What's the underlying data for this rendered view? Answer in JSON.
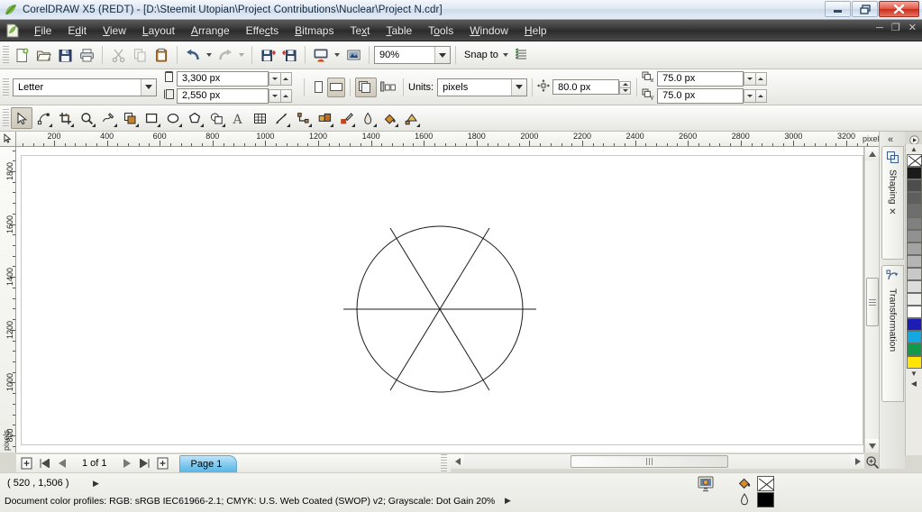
{
  "window": {
    "title": "CorelDRAW X5 (REDT) - [D:\\Steemit Utopian\\Project Contributions\\Nuclear\\Project N.cdr]",
    "app_icon": "coreldraw-icon",
    "minimize_label": "—",
    "restore_label": "❐",
    "close_label": "✕",
    "mdi_minimize": "—",
    "mdi_restore": "❐",
    "mdi_close": "✕"
  },
  "menu": {
    "items": [
      {
        "label": "File",
        "accel": "F"
      },
      {
        "label": "Edit",
        "accel": "E"
      },
      {
        "label": "View",
        "accel": "V"
      },
      {
        "label": "Layout",
        "accel": "L"
      },
      {
        "label": "Arrange",
        "accel": "A"
      },
      {
        "label": "Effects",
        "accel": "c"
      },
      {
        "label": "Bitmaps",
        "accel": "B"
      },
      {
        "label": "Text",
        "accel": "x"
      },
      {
        "label": "Table",
        "accel": "T"
      },
      {
        "label": "Tools",
        "accel": "o"
      },
      {
        "label": "Window",
        "accel": "W"
      },
      {
        "label": "Help",
        "accel": "H"
      }
    ]
  },
  "standard_toolbar": {
    "buttons": [
      {
        "name": "new-document-button",
        "tooltip": "New"
      },
      {
        "name": "open-document-button",
        "tooltip": "Open"
      },
      {
        "name": "save-document-button",
        "tooltip": "Save"
      },
      {
        "name": "print-button",
        "tooltip": "Print"
      },
      {
        "name": "cut-button",
        "tooltip": "Cut"
      },
      {
        "name": "copy-button",
        "tooltip": "Copy"
      },
      {
        "name": "paste-button",
        "tooltip": "Paste"
      },
      {
        "name": "undo-button",
        "tooltip": "Undo"
      },
      {
        "name": "redo-button",
        "tooltip": "Redo"
      },
      {
        "name": "import-button",
        "tooltip": "Import"
      },
      {
        "name": "export-button",
        "tooltip": "Export"
      },
      {
        "name": "publish-pdf-button",
        "tooltip": "Publish to PDF"
      },
      {
        "name": "application-launcher-button",
        "tooltip": "Application Launcher"
      }
    ],
    "zoom_level": "90%",
    "snap_to_label": "Snap to",
    "options_button": "options-button"
  },
  "property_bar": {
    "paper_type": "Letter",
    "page_width": "3,300 px",
    "page_height": "2,550 px",
    "orientation_portrait": "portrait-button",
    "orientation_landscape": "landscape-button",
    "all_pages_button": "all-pages-button",
    "current_page_button": "current-page-button",
    "units_label": "Units:",
    "units_value": "pixels",
    "nudge_offset": "80.0 px",
    "duplicate_x": "75.0 px",
    "duplicate_y": "75.0 px"
  },
  "toolbox": {
    "tools": [
      {
        "name": "pick-tool",
        "label": "Pick",
        "selected": true,
        "flyout": false
      },
      {
        "name": "shape-tool",
        "label": "Shape",
        "selected": false,
        "flyout": true
      },
      {
        "name": "crop-tool",
        "label": "Crop",
        "selected": false,
        "flyout": true
      },
      {
        "name": "zoom-tool",
        "label": "Zoom",
        "selected": false,
        "flyout": true
      },
      {
        "name": "freehand-tool",
        "label": "Freehand",
        "selected": false,
        "flyout": true
      },
      {
        "name": "smart-fill-tool",
        "label": "Smart Fill",
        "selected": false,
        "flyout": true
      },
      {
        "name": "rectangle-tool",
        "label": "Rectangle",
        "selected": false,
        "flyout": true
      },
      {
        "name": "ellipse-tool",
        "label": "Ellipse",
        "selected": false,
        "flyout": true
      },
      {
        "name": "polygon-tool",
        "label": "Polygon",
        "selected": false,
        "flyout": true
      },
      {
        "name": "basic-shapes-tool",
        "label": "Basic Shapes",
        "selected": false,
        "flyout": true
      },
      {
        "name": "text-tool",
        "label": "Text",
        "selected": false,
        "flyout": false
      },
      {
        "name": "table-tool",
        "label": "Table",
        "selected": false,
        "flyout": false
      },
      {
        "name": "dimension-tool",
        "label": "Dimension",
        "selected": false,
        "flyout": true
      },
      {
        "name": "connector-tool",
        "label": "Connector",
        "selected": false,
        "flyout": true
      },
      {
        "name": "blend-tool",
        "label": "Blend",
        "selected": false,
        "flyout": true
      },
      {
        "name": "color-eyedropper-tool",
        "label": "Color Eyedropper",
        "selected": false,
        "flyout": true
      },
      {
        "name": "outline-tool",
        "label": "Outline",
        "selected": false,
        "flyout": true
      },
      {
        "name": "fill-tool",
        "label": "Fill",
        "selected": false,
        "flyout": true
      },
      {
        "name": "interactive-fill-tool",
        "label": "Interactive Fill",
        "selected": false,
        "flyout": true
      }
    ]
  },
  "rulers": {
    "units": "pixels",
    "horizontal_ticks": [
      200,
      400,
      600,
      800,
      1000,
      1200,
      1400,
      1600,
      1800,
      2000,
      2200,
      2400,
      2600,
      2800,
      3000,
      3200
    ],
    "vertical_ticks": [
      1800,
      1600,
      1400,
      1200,
      1000,
      800
    ]
  },
  "dock": {
    "collapse_label": "«",
    "tabs": [
      {
        "name": "shaping-docker",
        "label": "Shaping",
        "icon": "shaping-icon",
        "close": "✕"
      },
      {
        "name": "transformation-docker",
        "label": "Transformation",
        "icon": "transformation-icon",
        "close": ""
      }
    ]
  },
  "palette": {
    "scroll_up": "▲",
    "scroll_down": "▼",
    "expand": "◀",
    "colors": [
      {
        "name": "no-color",
        "hex": "none"
      },
      {
        "name": "black",
        "hex": "#1a1a1a"
      },
      {
        "name": "gray-90",
        "hex": "#4d4d4d"
      },
      {
        "name": "gray-80",
        "hex": "#5e5e5e"
      },
      {
        "name": "gray-70",
        "hex": "#6e6e6e"
      },
      {
        "name": "gray-60",
        "hex": "#808080"
      },
      {
        "name": "gray-50",
        "hex": "#919191"
      },
      {
        "name": "gray-40",
        "hex": "#a3a3a3"
      },
      {
        "name": "gray-30",
        "hex": "#b5b5b5"
      },
      {
        "name": "gray-20",
        "hex": "#c8c8c8"
      },
      {
        "name": "gray-10",
        "hex": "#dcdcdc"
      },
      {
        "name": "gray-05",
        "hex": "#ececec"
      },
      {
        "name": "white",
        "hex": "#ffffff"
      },
      {
        "name": "blue",
        "hex": "#1d1db5"
      },
      {
        "name": "cyan",
        "hex": "#13a8e0"
      },
      {
        "name": "green",
        "hex": "#12994a"
      },
      {
        "name": "yellow",
        "hex": "#ffe400"
      }
    ]
  },
  "page_navigator": {
    "add_page_start": "add-page-before-button",
    "first_page": "⏮",
    "prev_page": "◀",
    "page_count_label": "1 of 1",
    "next_page": "▶",
    "last_page": "⏭",
    "add_page_end": "add-page-after-button",
    "tabs": [
      {
        "label": "Page 1",
        "active": true
      }
    ]
  },
  "status_bar": {
    "cursor_coordinates": "( 520  , 1,506 )",
    "coord_expand": "▶",
    "color_profiles": "Document color profiles: RGB: sRGB IEC61966-2.1; CMYK: U.S. Web Coated (SWOP) v2; Grayscale: Dot Gain 20%",
    "profiles_expand": "▶",
    "proof_colors_icon": "proof-colors-icon",
    "fill_label": "Fill",
    "fill_value": "none",
    "outline_label": "Outline",
    "outline_value": "#000000"
  },
  "drawing": {
    "shapes": [
      {
        "name": "circle",
        "type": "ellipse"
      },
      {
        "name": "horizontal-diameter-line",
        "type": "line",
        "angle_deg": 0
      },
      {
        "name": "diagonal-line-60",
        "type": "line",
        "angle_deg": 60
      },
      {
        "name": "diagonal-line-120",
        "type": "line",
        "angle_deg": 120
      }
    ],
    "stroke_color": "#000000",
    "fill_color": "none"
  }
}
